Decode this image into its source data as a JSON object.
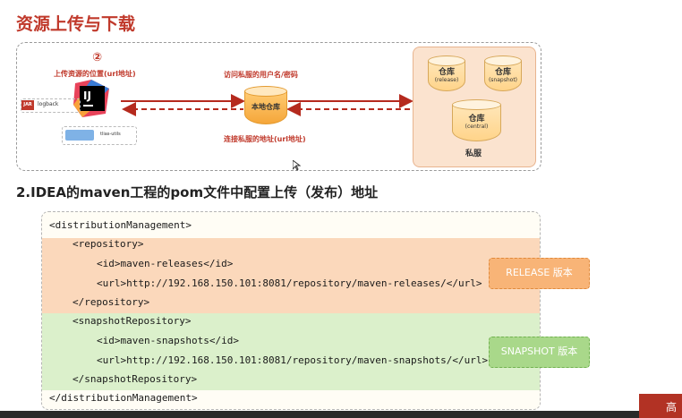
{
  "title": "资源上传与下载",
  "diagram": {
    "step_number": "②",
    "upload_label": "上传资源的位置(url地址)",
    "access_label": "访问私服的用户名/密码",
    "connect_label": "连接私服的地址(url地址)",
    "local_repo_label": "本地仓库",
    "jar_tag": "JAR",
    "jar_name": "logback",
    "lib_name": "tlias-utils",
    "private_server_label": "私服",
    "repos": [
      {
        "label": "仓库",
        "sub": "(release)"
      },
      {
        "label": "仓库",
        "sub": "(snapshot)"
      },
      {
        "label": "仓库",
        "sub": "(central)"
      }
    ],
    "ide_logo_text": "IJ",
    "colors": {
      "accent": "#c0392b",
      "private_bg": "#fbe3cf"
    }
  },
  "subtitle": "2.IDEA的maven工程的pom文件中配置上传（发布）地址",
  "code": {
    "lines": [
      "<distributionManagement>",
      "<repository>",
      "<id>maven-releases</id>",
      "<url>http://192.168.150.101:8081/repository/maven-releases/</url>",
      "</repository>",
      "<snapshotRepository>",
      "<id>maven-snapshots</id>",
      "<url>http://192.168.150.101:8081/repository/maven-snapshots/</url>",
      "</snapshotRepository>",
      "</distributionManagement>"
    ],
    "release_tag": "RELEASE 版本",
    "snapshot_tag": "SNAPSHOT 版本"
  },
  "video": {
    "button_text": "高"
  }
}
